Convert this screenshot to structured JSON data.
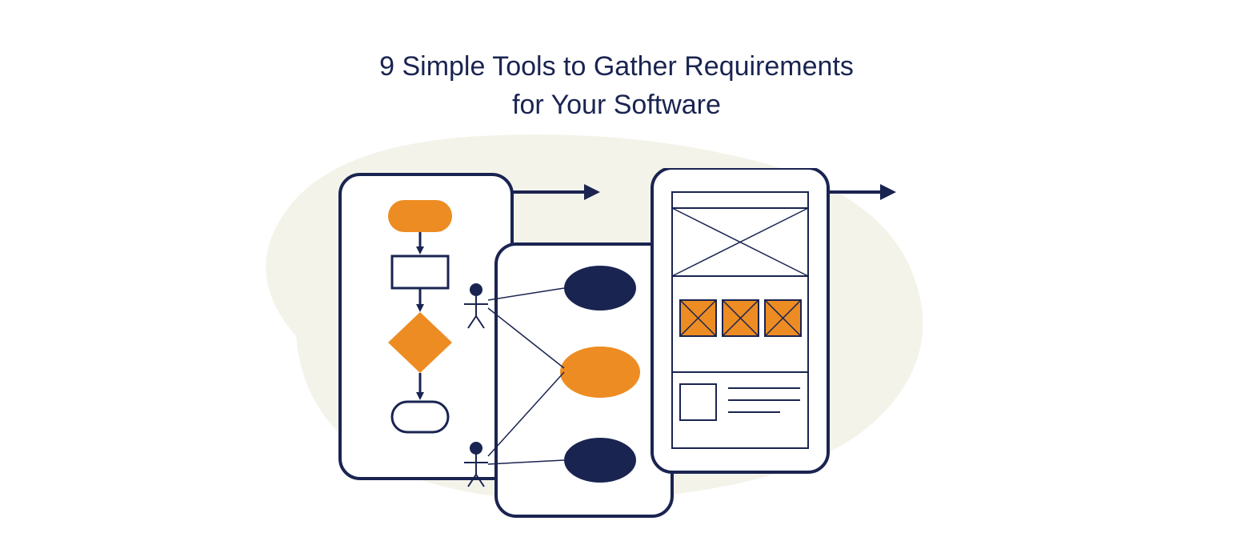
{
  "title_line1": "9 Simple Tools to Gather Requirements",
  "title_line2": "for Your Software",
  "colors": {
    "navy": "#1a2451",
    "orange": "#ed8c23",
    "cream": "#f4f3ea",
    "white": "#ffffff"
  },
  "illustration": {
    "description": "Three overlapping diagram cards showing flowchart, use case diagram with actors, and wireframe mockup, with arrows pointing right"
  }
}
